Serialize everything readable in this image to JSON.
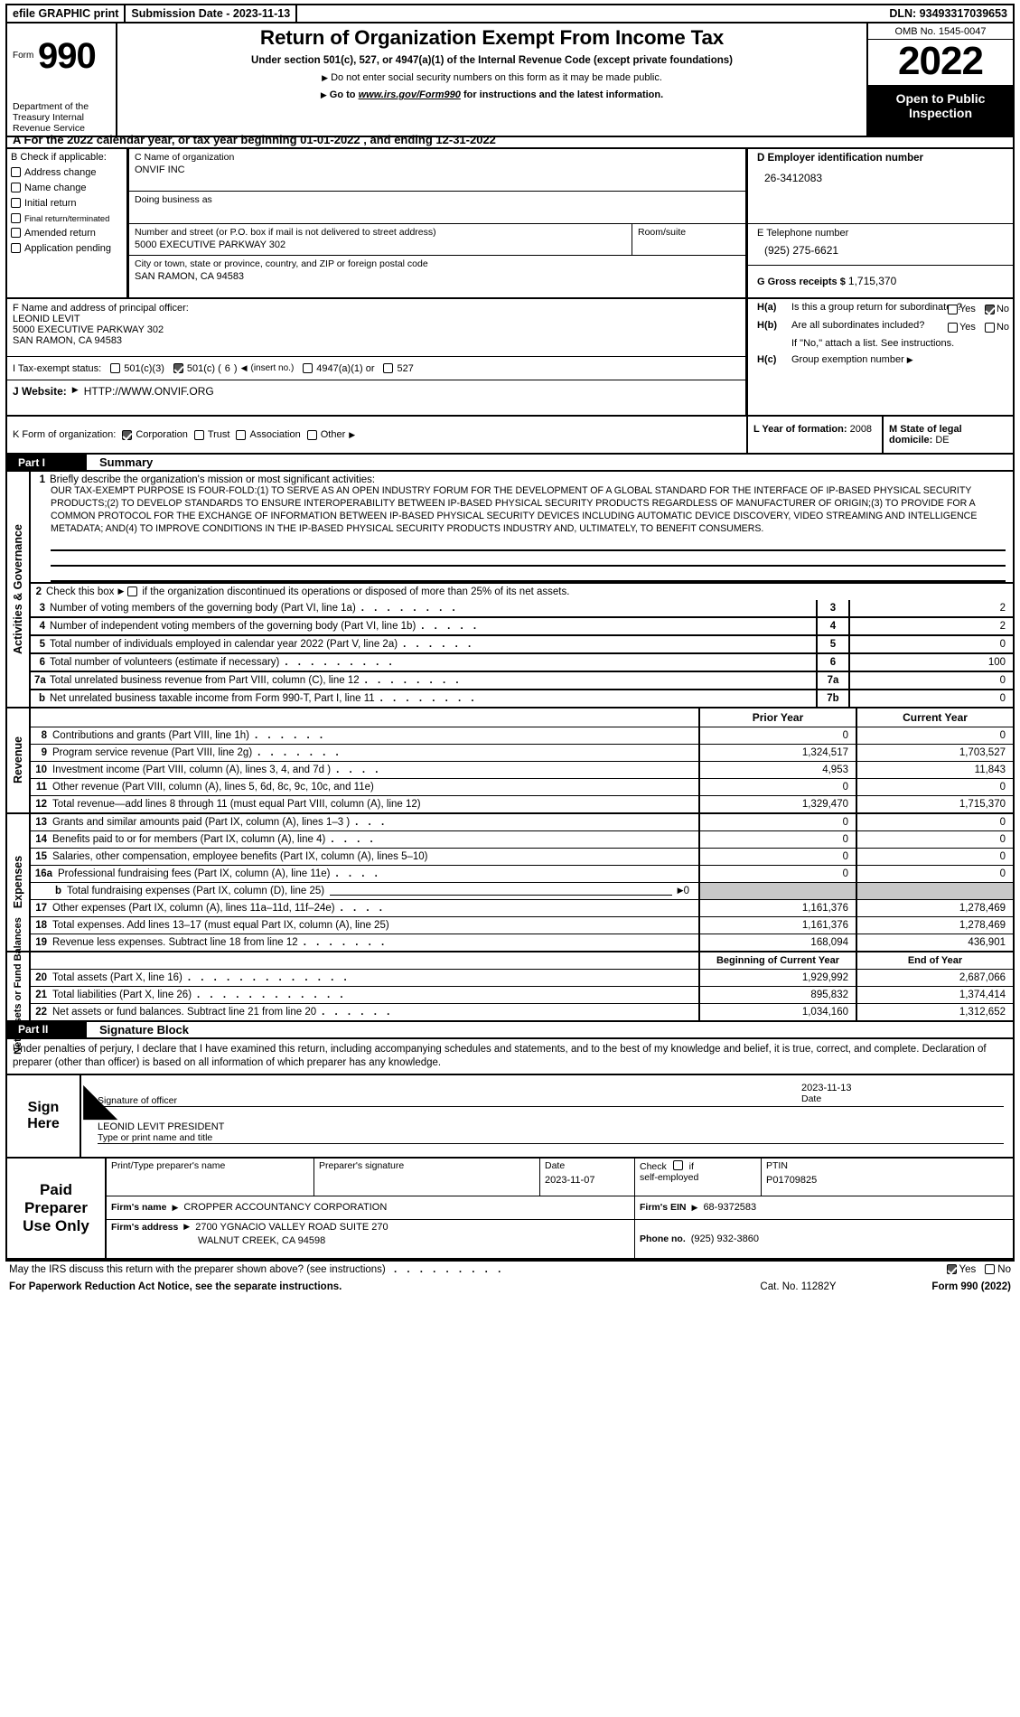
{
  "efile": {
    "print_label": "efile GRAPHIC print",
    "submission": "Submission Date - 2023-11-13",
    "dln": "DLN: 93493317039653"
  },
  "masthead": {
    "form_label": "Form",
    "form_number": "990",
    "department": "Department of the Treasury Internal Revenue Service",
    "title": "Return of Organization Exempt From Income Tax",
    "subtitle": "Under section 501(c), 527, or 4947(a)(1) of the Internal Revenue Code (except private foundations)",
    "note1": "Do not enter social security numbers on this form as it may be made public.",
    "note2_pre": "Go to",
    "note2_link": "www.irs.gov/Form990",
    "note2_post": "for instructions and the latest information.",
    "omb": "OMB No. 1545-0047",
    "year": "2022",
    "open_to_public": "Open to Public Inspection"
  },
  "line_a": "A For the 2022 calendar year, or tax year beginning 01-01-2022   , and ending 12-31-2022",
  "section_b": {
    "label": "B  Check if applicable:",
    "items": [
      {
        "label": "Address change",
        "checked": false
      },
      {
        "label": "Name change",
        "checked": false
      },
      {
        "label": "Initial return",
        "checked": false
      },
      {
        "label": "Final return/terminated",
        "checked": false
      },
      {
        "label": "Amended return",
        "checked": false
      },
      {
        "label": "Application pending",
        "checked": false
      }
    ]
  },
  "section_c": {
    "name_label": "C Name of organization",
    "name_value": "ONVIF INC",
    "dba_label": "Doing business as",
    "dba_value": "",
    "street_label": "Number and street (or P.O. box if mail is not delivered to street address)",
    "street_value": "5000 EXECUTIVE PARKWAY 302",
    "room_label": "Room/suite",
    "room_value": "",
    "city_label": "City or town, state or province, country, and ZIP or foreign postal code",
    "city_value": "SAN RAMON, CA  94583"
  },
  "section_d": {
    "ein_label": "D Employer identification number",
    "ein_value": "26-3412083",
    "phone_label": "E Telephone number",
    "phone_value": "(925) 275-6621",
    "gross_label": "G Gross receipts $",
    "gross_value": "1,715,370"
  },
  "section_f": {
    "label": "F  Name and address of principal officer:",
    "name": "LEONID LEVIT",
    "address1": "5000 EXECUTIVE PARKWAY 302",
    "address2": "SAN RAMON, CA  94583"
  },
  "section_h": {
    "ha_label": "H(a)",
    "ha_text": "Is this a group return for subordinates?",
    "ha_yes": "Yes",
    "ha_no": "No",
    "ha_yes_checked": false,
    "ha_no_checked": true,
    "hb_label": "H(b)",
    "hb_text": "Are all subordinates included?",
    "hb_yes": "Yes",
    "hb_no": "No",
    "hb_yes_checked": false,
    "hb_no_checked": false,
    "hb_note": "If \"No,\" attach a list. See instructions.",
    "hc_label": "H(c)",
    "hc_text": "Group exemption number",
    "hc_value": ""
  },
  "section_i": {
    "label": "I   Tax-exempt status:",
    "opt1": "501(c)(3)",
    "opt1_checked": false,
    "opt2_pre": "501(c) (",
    "opt2_num": "6",
    "opt2_post": ") ",
    "opt2_insert": "(insert no.)",
    "opt2_checked": true,
    "opt3": "4947(a)(1) or",
    "opt3_checked": false,
    "opt4": "527",
    "opt4_checked": false
  },
  "section_j": {
    "label": "J   Website:",
    "value": "HTTP://WWW.ONVIF.ORG"
  },
  "section_k": {
    "label": "K Form of organization:",
    "opts": [
      {
        "label": "Corporation",
        "checked": true
      },
      {
        "label": "Trust",
        "checked": false
      },
      {
        "label": "Association",
        "checked": false
      },
      {
        "label": "Other",
        "checked": false
      }
    ]
  },
  "section_l": {
    "label": "L Year of formation:",
    "value": "2008"
  },
  "section_m": {
    "label": "M State of legal domicile:",
    "value": "DE"
  },
  "part1": {
    "bar_part": "Part I",
    "bar_title": "Summary",
    "side_label": "Activities & Governance",
    "line1_num": "1",
    "line1_label": "Briefly describe the organization's mission or most significant activities:",
    "mission": "OUR TAX-EXEMPT PURPOSE IS FOUR-FOLD:(1) TO SERVE AS AN OPEN INDUSTRY FORUM FOR THE DEVELOPMENT OF A GLOBAL STANDARD FOR THE INTERFACE OF IP-BASED PHYSICAL SECURITY PRODUCTS;(2) TO DEVELOP STANDARDS TO ENSURE INTEROPERABILITY BETWEEN IP-BASED PHYSICAL SECURITY PRODUCTS REGARDLESS OF MANUFACTURER OF ORIGIN;(3) TO PROVIDE FOR A COMMON PROTOCOL FOR THE EXCHANGE OF INFORMATION BETWEEN IP-BASED PHYSICAL SECURITY DEVICES INCLUDING AUTOMATIC DEVICE DISCOVERY, VIDEO STREAMING AND INTELLIGENCE METADATA; AND(4) TO IMPROVE CONDITIONS IN THE IP-BASED PHYSICAL SECURITY PRODUCTS INDUSTRY AND, ULTIMATELY, TO BENEFIT CONSUMERS.",
    "line2_num": "2",
    "line2_text_a": "Check this box",
    "line2_text_b": "if the organization discontinued its operations or disposed of more than 25% of its net assets.",
    "line2_checked": false,
    "gov_rows": [
      {
        "num": "3",
        "desc": "Number of voting members of the governing body (Part VI, line 1a)",
        "dots": ". . . . . . . .",
        "value": "2"
      },
      {
        "num": "4",
        "desc": "Number of independent voting members of the governing body (Part VI, line 1b)",
        "dots": ". . . . .",
        "value": "2"
      },
      {
        "num": "5",
        "desc": "Total number of individuals employed in calendar year 2022 (Part V, line 2a)",
        "dots": ". . . . . .",
        "value": "0"
      },
      {
        "num": "6",
        "desc": "Total number of volunteers (estimate if necessary)",
        "dots": ". . . . . . . . .",
        "value": "100"
      },
      {
        "num": "7a",
        "desc": "Total unrelated business revenue from Part VIII, column (C), line 12",
        "dots": ". . . . . . . .",
        "value": "0"
      },
      {
        "num": "7b",
        "desc": "Net unrelated business taxable income from Form 990-T, Part I, line 11",
        "dots": ". . . . . . . .",
        "value": "0"
      }
    ],
    "revenue_side": "Revenue",
    "expenses_side": "Expenses",
    "netassets_side": "Net Assets or Fund Balances",
    "col_prior": "Prior Year",
    "col_current": "Current Year",
    "col_begin": "Beginning of Current Year",
    "col_end": "End of Year",
    "revenue_rows": [
      {
        "num": "8",
        "desc": "Contributions and grants (Part VIII, line 1h)",
        "dots": ". . . . . .",
        "prior": "0",
        "current": "0"
      },
      {
        "num": "9",
        "desc": "Program service revenue (Part VIII, line 2g)",
        "dots": ". . . . . . .",
        "prior": "1,324,517",
        "current": "1,703,527"
      },
      {
        "num": "10",
        "desc": "Investment income (Part VIII, column (A), lines 3, 4, and 7d )",
        "dots": ". . . .",
        "prior": "4,953",
        "current": "11,843"
      },
      {
        "num": "11",
        "desc": "Other revenue (Part VIII, column (A), lines 5, 6d, 8c, 9c, 10c, and 11e)",
        "dots": "",
        "prior": "0",
        "current": "0"
      },
      {
        "num": "12",
        "desc": "Total revenue—add lines 8 through 11 (must equal Part VIII, column (A), line 12)",
        "dots": "",
        "prior": "1,329,470",
        "current": "1,715,370"
      }
    ],
    "expense_rows": [
      {
        "num": "13",
        "desc": "Grants and similar amounts paid (Part IX, column (A), lines 1–3 )",
        "dots": ". . .",
        "prior": "0",
        "current": "0"
      },
      {
        "num": "14",
        "desc": "Benefits paid to or for members (Part IX, column (A), line 4)",
        "dots": ". . . .",
        "prior": "0",
        "current": "0"
      },
      {
        "num": "15",
        "desc": "Salaries, other compensation, employee benefits (Part IX, column (A), lines 5–10)",
        "dots": "",
        "prior": "0",
        "current": "0"
      },
      {
        "num": "16a",
        "desc": "Professional fundraising fees (Part IX, column (A), line 11e)",
        "dots": ". . . .",
        "prior": "0",
        "current": "0"
      },
      {
        "num": "b",
        "desc": "Total fundraising expenses (Part IX, column (D), line 25)",
        "dots": "",
        "sub": true,
        "suffix": "0",
        "prior": "",
        "current": "",
        "grey": true
      },
      {
        "num": "17",
        "desc": "Other expenses (Part IX, column (A), lines 11a–11d, 11f–24e)",
        "dots": ". . . .",
        "prior": "1,161,376",
        "current": "1,278,469"
      },
      {
        "num": "18",
        "desc": "Total expenses. Add lines 13–17 (must equal Part IX, column (A), line 25)",
        "dots": "",
        "prior": "1,161,376",
        "current": "1,278,469"
      },
      {
        "num": "19",
        "desc": "Revenue less expenses. Subtract line 18 from line 12",
        "dots": ". . . . . . .",
        "prior": "168,094",
        "current": "436,901"
      }
    ],
    "netasset_rows": [
      {
        "num": "20",
        "desc": "Total assets (Part X, line 16)",
        "dots": ". . . . . . . . . . . . .",
        "begin": "1,929,992",
        "end": "2,687,066"
      },
      {
        "num": "21",
        "desc": "Total liabilities (Part X, line 26)",
        "dots": ". . . . . . . . . . . .",
        "begin": "895,832",
        "end": "1,374,414"
      },
      {
        "num": "22",
        "desc": "Net assets or fund balances. Subtract line 21 from line 20",
        "dots": ". . . . . .",
        "begin": "1,034,160",
        "end": "1,312,652"
      }
    ]
  },
  "part2": {
    "bar_part": "Part II",
    "bar_title": "Signature Block",
    "perjury": "Under penalties of perjury, I declare that I have examined this return, including accompanying schedules and statements, and to the best of my knowledge and belief, it is true, correct, and complete. Declaration of preparer (other than officer) is based on all information of which preparer has any knowledge.",
    "sign_here_1": "Sign",
    "sign_here_2": "Here",
    "sig_officer_label": "Signature of officer",
    "sig_date_label": "Date",
    "sig_date_value": "2023-11-13",
    "officer_name_value": "LEONID LEVIT  PRESIDENT",
    "officer_name_label": "Type or print name and title"
  },
  "preparer": {
    "lbl1": "Paid",
    "lbl2": "Preparer",
    "lbl3": "Use Only",
    "h_printname": "Print/Type preparer's name",
    "h_signature": "Preparer's signature",
    "h_date": "Date",
    "h_date_value": "2023-11-07",
    "h_check": "Check",
    "h_check_if": "if",
    "h_selfemployed": "self-employed",
    "h_check_checked": false,
    "h_ptin": "PTIN",
    "h_ptin_value": "P01709825",
    "firm_name_label": "Firm's name",
    "firm_name_value": "CROPPER ACCOUNTANCY CORPORATION",
    "firm_ein_label": "Firm's EIN",
    "firm_ein_value": "68-9372583",
    "firm_addr_label": "Firm's address",
    "firm_addr_value": "2700 YGNACIO VALLEY ROAD SUITE 270",
    "firm_addr_value2": "WALNUT CREEK, CA  94598",
    "phone_label": "Phone no.",
    "phone_value": "(925) 932-3860"
  },
  "footer": {
    "discuss": "May the IRS discuss this return with the preparer shown above? (see instructions)",
    "discuss_dots": ". . . . . . . . .",
    "yes": "Yes",
    "no": "No",
    "yes_checked": true,
    "no_checked": false,
    "paperwork": "For Paperwork Reduction Act Notice, see the separate instructions.",
    "cat": "Cat. No. 11282Y",
    "formref": "Form 990 (2022)"
  }
}
